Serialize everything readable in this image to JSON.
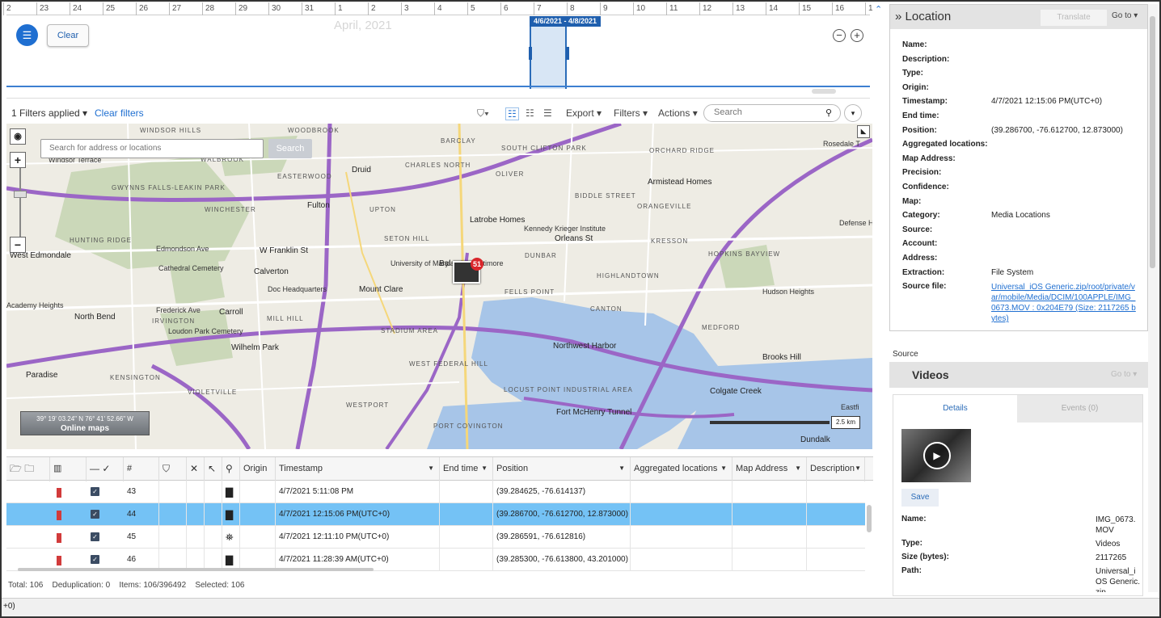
{
  "timeline": {
    "ticks": [
      "2",
      "23",
      "24",
      "25",
      "26",
      "27",
      "28",
      "29",
      "30",
      "31",
      "1",
      "2",
      "3",
      "4",
      "5",
      "6",
      "7",
      "8",
      "9",
      "10",
      "11",
      "12",
      "13",
      "14",
      "15",
      "16",
      "1"
    ],
    "month_label": "April, 2021",
    "range_label": "4/6/2021 - 4/8/2021",
    "clear_label": "Clear"
  },
  "filterbar": {
    "filters_applied": "1 Filters applied",
    "clear_filters": "Clear filters",
    "export": "Export",
    "filters": "Filters",
    "actions": "Actions",
    "search_placeholder": "Search"
  },
  "map": {
    "search_placeholder": "Search for address or locations",
    "search_button": "Search",
    "coord_text": "39° 19' 03.24\" N 76° 41' 52.66\" W",
    "online_maps": "Online maps",
    "scale": "2.5 km",
    "cluster_count": "51",
    "labels": [
      {
        "t": "WINDSOR HILLS",
        "c": "caps"
      },
      {
        "t": "WOODBROOK",
        "c": "caps"
      },
      {
        "t": "BARCLAY",
        "c": "caps"
      },
      {
        "t": "SOUTH CLIFTON PARK",
        "c": "caps"
      },
      {
        "t": "ORCHARD RIDGE",
        "c": "caps"
      },
      {
        "t": "Rosedale T",
        "c": ""
      },
      {
        "t": "Windsor Terrace",
        "c": ""
      },
      {
        "t": "WALBROOK",
        "c": "caps"
      },
      {
        "t": "EASTERWOOD",
        "c": "caps"
      },
      {
        "t": "Druid",
        "c": "big"
      },
      {
        "t": "CHARLES NORTH",
        "c": "caps"
      },
      {
        "t": "OLIVER",
        "c": "caps"
      },
      {
        "t": "Armistead Homes",
        "c": "big"
      },
      {
        "t": "GWYNNS FALLS-LEAKIN PARK",
        "c": "caps"
      },
      {
        "t": "BIDDLE STREET",
        "c": "caps"
      },
      {
        "t": "WINCHESTER",
        "c": "caps"
      },
      {
        "t": "Fulton",
        "c": "big"
      },
      {
        "t": "UPTON",
        "c": "caps"
      },
      {
        "t": "Latrobe Homes",
        "c": "big"
      },
      {
        "t": "ORANGEVILLE",
        "c": "caps"
      },
      {
        "t": "Defense Heights",
        "c": ""
      },
      {
        "t": "HUNTING RIDGE",
        "c": "caps"
      },
      {
        "t": "Edmondson Ave",
        "c": ""
      },
      {
        "t": "SETON HILL",
        "c": "caps"
      },
      {
        "t": "Kennedy Krieger Institute",
        "c": ""
      },
      {
        "t": "Orleans St",
        "c": "big"
      },
      {
        "t": "KRESSON",
        "c": "caps"
      },
      {
        "t": "West Edmondale",
        "c": "big"
      },
      {
        "t": "W Franklin St",
        "c": "big"
      },
      {
        "t": "DUNBAR",
        "c": "caps"
      },
      {
        "t": "HOPKINS BAYVIEW",
        "c": "caps"
      },
      {
        "t": "Cathedral Cemetery",
        "c": ""
      },
      {
        "t": "Calverton",
        "c": "big"
      },
      {
        "t": "University of Maryland at Baltimore",
        "c": ""
      },
      {
        "t": "Bal",
        "c": "big"
      },
      {
        "t": "HIGHLANDTOWN",
        "c": "caps"
      },
      {
        "t": "Doc Headquarters",
        "c": ""
      },
      {
        "t": "Mount Clare",
        "c": "big"
      },
      {
        "t": "FELLS POINT",
        "c": "caps"
      },
      {
        "t": "Hudson Heights",
        "c": ""
      },
      {
        "t": "Academy Heights",
        "c": ""
      },
      {
        "t": "North Bend",
        "c": "big"
      },
      {
        "t": "Frederick Ave",
        "c": ""
      },
      {
        "t": "Carroll",
        "c": "big"
      },
      {
        "t": "IRVINGTON",
        "c": "caps"
      },
      {
        "t": "MILL HILL",
        "c": "caps"
      },
      {
        "t": "CANTON",
        "c": "caps"
      },
      {
        "t": "STADIUM AREA",
        "c": "caps"
      },
      {
        "t": "MEDFORD",
        "c": "caps"
      },
      {
        "t": "Loudon Park Cemetery",
        "c": ""
      },
      {
        "t": "Wilhelm Park",
        "c": "big"
      },
      {
        "t": "Northwest Harbor",
        "c": "big"
      },
      {
        "t": "Brooks Hill",
        "c": "big"
      },
      {
        "t": "WEST FEDERAL HILL",
        "c": "caps"
      },
      {
        "t": "Paradise",
        "c": "big"
      },
      {
        "t": "KENSINGTON",
        "c": "caps"
      },
      {
        "t": "LOCUST POINT INDUSTRIAL AREA",
        "c": "caps"
      },
      {
        "t": "Colgate Creek",
        "c": "big"
      },
      {
        "t": "VIOLETVILLE",
        "c": "caps"
      },
      {
        "t": "WESTPORT",
        "c": "caps"
      },
      {
        "t": "Fort McHenry Tunnel",
        "c": "big"
      },
      {
        "t": "PORT COVINGTON",
        "c": "caps"
      },
      {
        "t": "Eastfi",
        "c": ""
      },
      {
        "t": "Dundalk",
        "c": "big"
      }
    ]
  },
  "grid": {
    "headers": [
      "Origin",
      "Timestamp",
      "End time",
      "Position",
      "Aggregated locations",
      "Map Address",
      "Description"
    ],
    "hash": "#",
    "rows": [
      {
        "num": "43",
        "timestamp": "4/7/2021 5:11:08 PM",
        "position": "(39.284625, -76.614137)",
        "selected": false
      },
      {
        "num": "44",
        "timestamp": "4/7/2021 12:15:06 PM(UTC+0)",
        "position": "(39.286700, -76.612700, 12.873000)",
        "selected": true
      },
      {
        "num": "45",
        "timestamp": "4/7/2021 12:11:10 PM(UTC+0)",
        "position": "(39.286591, -76.612816)",
        "selected": false
      },
      {
        "num": "46",
        "timestamp": "4/7/2021 11:28:39 AM(UTC+0)",
        "position": "(39.285300, -76.613800, 43.201000)",
        "selected": false
      }
    ],
    "status": {
      "total": "Total: 106",
      "dedup": "Deduplication: 0",
      "items": "Items: 106/396492",
      "selected": "Selected: 106"
    }
  },
  "bottom_text": "+0)",
  "location_panel": {
    "title": "Location",
    "translate": "Translate",
    "goto": "Go to",
    "fields": [
      {
        "k": "Name:",
        "v": ""
      },
      {
        "k": "Description:",
        "v": ""
      },
      {
        "k": "Type:",
        "v": ""
      },
      {
        "k": "Origin:",
        "v": ""
      },
      {
        "k": "Timestamp:",
        "v": "4/7/2021 12:15:06 PM(UTC+0)"
      },
      {
        "k": "End time:",
        "v": ""
      },
      {
        "k": "Position:",
        "v": "(39.286700, -76.612700, 12.873000)"
      },
      {
        "k": "Aggregated locations:",
        "v": ""
      },
      {
        "k": "Map Address:",
        "v": ""
      },
      {
        "k": "Precision:",
        "v": ""
      },
      {
        "k": "Confidence:",
        "v": ""
      },
      {
        "k": "Map:",
        "v": ""
      },
      {
        "k": "Category:",
        "v": "Media Locations"
      },
      {
        "k": "Source:",
        "v": ""
      },
      {
        "k": "Account:",
        "v": ""
      },
      {
        "k": "Address:",
        "v": ""
      },
      {
        "k": "Extraction:",
        "v": "File System"
      },
      {
        "k": "Source file:",
        "v": "Universal_iOS Generic.zip/root/private/var/mobile/Media/DCIM/100APPLE/IMG_0673.MOV : 0x204E79 (Size: 2117265 bytes)"
      }
    ]
  },
  "source_label": "Source",
  "videos_panel": {
    "title": "Videos",
    "goto": "Go to",
    "tab_details": "Details",
    "tab_events": "Events (0)",
    "save": "Save",
    "fields": [
      {
        "k": "Name:",
        "v": "IMG_0673.MOV"
      },
      {
        "k": "Type:",
        "v": "Videos"
      },
      {
        "k": "Size (bytes):",
        "v": "2117265"
      },
      {
        "k": "Path:",
        "v": "Universal_iOS Generic.zip"
      }
    ]
  }
}
